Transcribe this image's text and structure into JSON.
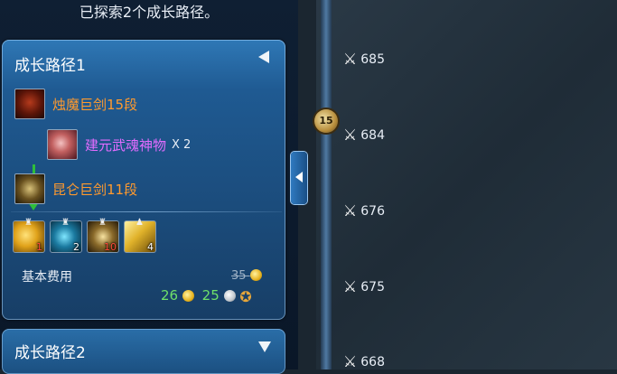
{
  "header": {
    "message": "已探索2个成长路径。"
  },
  "path1": {
    "title": "成长路径1",
    "source_item": {
      "name": "烛魔巨剑15段",
      "icon": "sword-icon"
    },
    "material_item": {
      "name": "建元武魂神物",
      "qty": "X 2",
      "icon": "flower-icon"
    },
    "target_item": {
      "name": "昆仑巨剑11段",
      "icon": "sword-icon"
    },
    "materials": [
      {
        "icon": "gold-orb-icon",
        "count": "1",
        "count_color": "#ff4a3a"
      },
      {
        "icon": "blue-gem-icon",
        "count": "2",
        "count_color": "#ffffff"
      },
      {
        "icon": "ore-icon",
        "count": "10",
        "count_color": "#ff4a3a"
      },
      {
        "icon": "gold-ticket-icon",
        "count": "4",
        "count_color": "#ffffff"
      }
    ],
    "fee": {
      "label": "基本费用",
      "original": "35",
      "gold": "26",
      "silver": "25"
    }
  },
  "path2": {
    "title": "成长路径2"
  },
  "timeline": {
    "current_level": "15",
    "power_values": [
      "685",
      "684",
      "676",
      "675",
      "668"
    ]
  },
  "colors": {
    "item_orange": "#ff9a2e",
    "item_purple": "#e26cff",
    "arrow_green": "#2fbe3a",
    "fee_green": "#6ee06a"
  }
}
